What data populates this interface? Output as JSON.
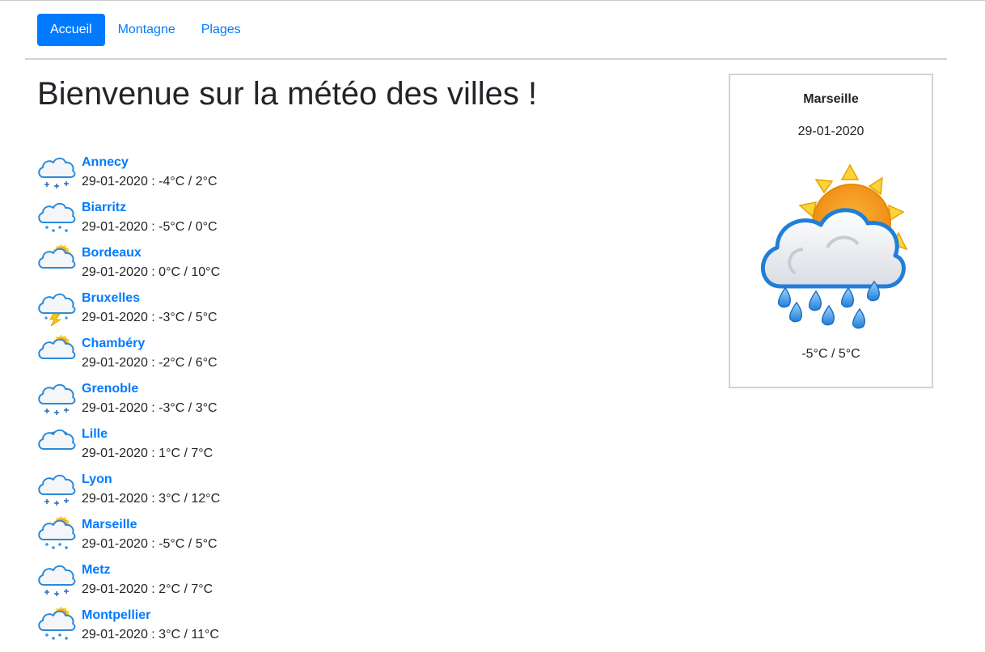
{
  "nav": {
    "items": [
      {
        "label": "Accueil"
      },
      {
        "label": "Montagne"
      },
      {
        "label": "Plages"
      }
    ]
  },
  "page": {
    "title": "Bienvenue sur la météo des villes !"
  },
  "cities": [
    {
      "name": "Annecy",
      "info": "29-01-2020 : -4°C / 2°C",
      "icon": "snow-cloud-icon"
    },
    {
      "name": "Biarritz",
      "info": "29-01-2020 : -5°C / 0°C",
      "icon": "rain-cloud-icon"
    },
    {
      "name": "Bordeaux",
      "info": "29-01-2020 : 0°C / 10°C",
      "icon": "sun-cloud-icon"
    },
    {
      "name": "Bruxelles",
      "info": "29-01-2020 : -3°C / 5°C",
      "icon": "storm-cloud-icon"
    },
    {
      "name": "Chambéry",
      "info": "29-01-2020 : -2°C / 6°C",
      "icon": "sun-cloud-icon"
    },
    {
      "name": "Grenoble",
      "info": "29-01-2020 : -3°C / 3°C",
      "icon": "snow-cloud-icon"
    },
    {
      "name": "Lille",
      "info": "29-01-2020 : 1°C / 7°C",
      "icon": "cloudy-icon"
    },
    {
      "name": "Lyon",
      "info": "29-01-2020 : 3°C / 12°C",
      "icon": "snow-cloud-icon"
    },
    {
      "name": "Marseille",
      "info": "29-01-2020 : -5°C / 5°C",
      "icon": "sun-rain-cloud-icon"
    },
    {
      "name": "Metz",
      "info": "29-01-2020 : 2°C / 7°C",
      "icon": "snow-cloud-icon"
    },
    {
      "name": "Montpellier",
      "info": "29-01-2020 : 3°C / 11°C",
      "icon": "sun-rain-cloud-icon"
    }
  ],
  "card": {
    "city": "Marseille",
    "date": "29-01-2020",
    "temp": "-5°C / 5°C",
    "icon": "sun-rain-cloud-icon"
  },
  "colors": {
    "accent": "#007bff",
    "text": "#212529"
  }
}
